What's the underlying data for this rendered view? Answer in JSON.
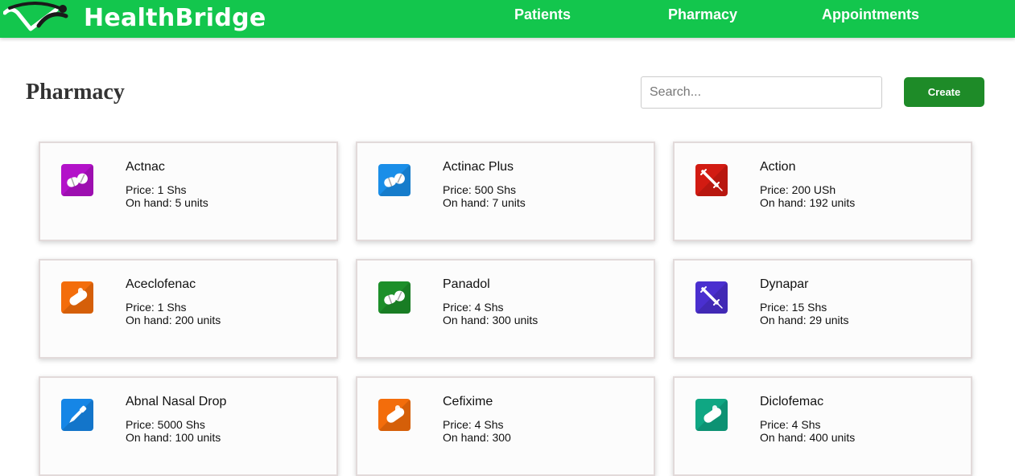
{
  "app": {
    "brand": "HealthBridge"
  },
  "nav": {
    "items": [
      {
        "label": "Patients"
      },
      {
        "label": "Pharmacy"
      },
      {
        "label": "Appointments"
      }
    ]
  },
  "page": {
    "title": "Pharmacy",
    "search_placeholder": "Search...",
    "search_value": "",
    "create_label": "Create"
  },
  "colors": {
    "navbar": "#13c64d",
    "create_button": "#1e8b28"
  },
  "medicines": [
    {
      "name": "Actnac",
      "price": "Price: 1 Shs",
      "on_hand": "On hand: 5 units",
      "icon": "pill-icon",
      "color": "#b312c9"
    },
    {
      "name": "Actinac Plus",
      "price": "Price: 500 Shs",
      "on_hand": "On hand: 7 units",
      "icon": "pill-icon",
      "color": "#1a8ee8"
    },
    {
      "name": "Action",
      "price": "Price: 200 USh",
      "on_hand": "On hand: 192 units",
      "icon": "syringe-icon",
      "color": "#d21b12"
    },
    {
      "name": "Aceclofenac",
      "price": "Price: 1 Shs",
      "on_hand": "On hand: 200 units",
      "icon": "capsule-icon",
      "color": "#f36d0b"
    },
    {
      "name": "Panadol",
      "price": "Price: 4 Shs",
      "on_hand": "On hand: 300 units",
      "icon": "pill-icon",
      "color": "#1d8f2a"
    },
    {
      "name": "Dynapar",
      "price": "Price: 15 Shs",
      "on_hand": "On hand: 29 units",
      "icon": "syringe-icon",
      "color": "#4a2fcf"
    },
    {
      "name": "Abnal Nasal Drop",
      "price": "Price: 5000 Shs",
      "on_hand": "On hand: 100 units",
      "icon": "dropper-icon",
      "color": "#1686e6"
    },
    {
      "name": "Cefixime",
      "price": "Price: 4 Shs",
      "on_hand": "On hand: 300",
      "icon": "capsule-icon",
      "color": "#f36d0b"
    },
    {
      "name": "Diclofemac",
      "price": "Price: 4 Shs",
      "on_hand": "On hand: 400 units",
      "icon": "capsule-icon",
      "color": "#0fa783"
    }
  ]
}
